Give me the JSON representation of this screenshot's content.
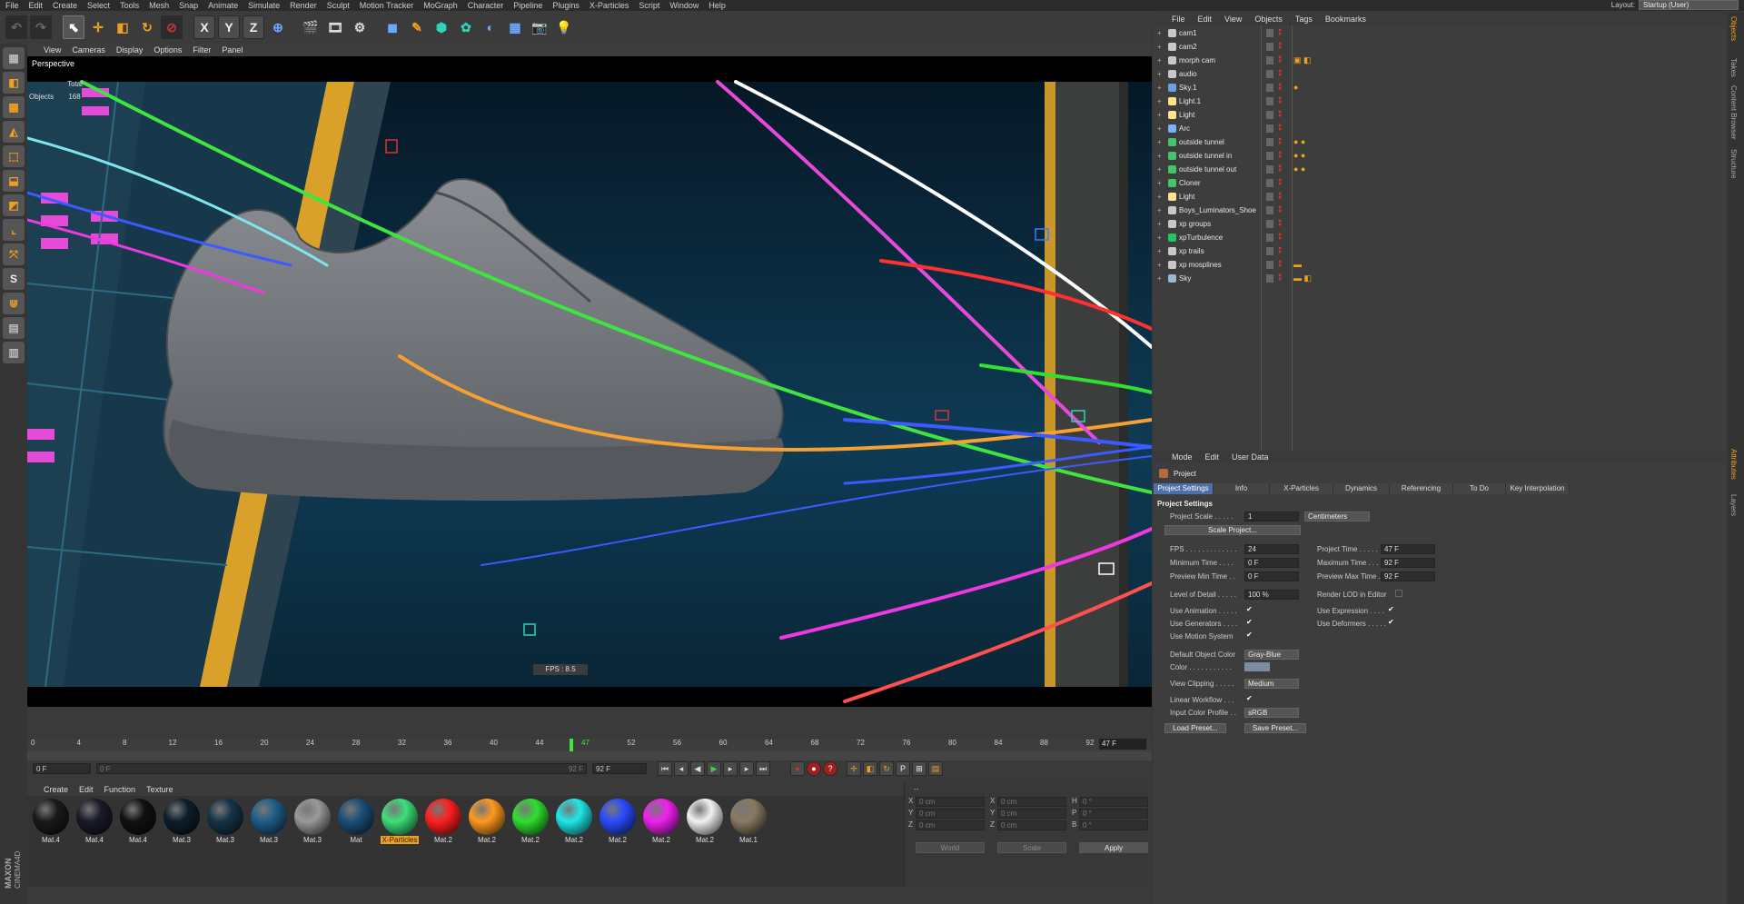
{
  "menubar": [
    "File",
    "Edit",
    "Create",
    "Select",
    "Tools",
    "Mesh",
    "Snap",
    "Animate",
    "Simulate",
    "Render",
    "Sculpt",
    "Motion Tracker",
    "MoGraph",
    "Character",
    "Pipeline",
    "Plugins",
    "X-Particles",
    "Script",
    "Window",
    "Help"
  ],
  "layout": {
    "label": "Layout:",
    "value": "Startup (User)"
  },
  "viewport": {
    "menu": [
      "View",
      "Cameras",
      "Display",
      "Options",
      "Filter",
      "Panel"
    ],
    "label": "Perspective",
    "stats_total": "Total",
    "stats_objects_label": "Objects",
    "stats_objects_value": "168",
    "fps": "FPS : 8.5"
  },
  "timeline": {
    "ticks": [
      "0",
      "4",
      "8",
      "12",
      "16",
      "20",
      "24",
      "28",
      "32",
      "36",
      "40",
      "44",
      "47",
      "52",
      "56",
      "60",
      "64",
      "68",
      "72",
      "76",
      "80",
      "84",
      "88",
      "92"
    ],
    "current_frame": "47 F",
    "start_field": "0 F",
    "min_field": "0 F",
    "max_field": "92 F",
    "end_field": "92 F"
  },
  "materials": {
    "menu": [
      "Create",
      "Edit",
      "Function",
      "Texture"
    ],
    "items": [
      {
        "label": "Mat.4",
        "color": "#1a1a1a",
        "hl": false
      },
      {
        "label": "Mat.4",
        "color": "#1a1a2a",
        "hl": false
      },
      {
        "label": "Mat.4",
        "color": "#111111",
        "hl": false
      },
      {
        "label": "Mat.3",
        "color": "#0d1e2a",
        "hl": false
      },
      {
        "label": "Mat.3",
        "color": "#143447",
        "hl": false
      },
      {
        "label": "Mat.3",
        "color": "#1f5d8a",
        "hl": false
      },
      {
        "label": "Mat.3",
        "color": "#9a9a9a",
        "hl": false
      },
      {
        "label": "Mat",
        "color": "#1b4e77",
        "hl": false
      },
      {
        "label": "X-Particles",
        "color": "#3de07a",
        "hl": true
      },
      {
        "label": "Mat.2",
        "color": "#ff1f1f",
        "hl": false
      },
      {
        "label": "Mat.2",
        "color": "#ff9a1f",
        "hl": false
      },
      {
        "label": "Mat.2",
        "color": "#2fe02f",
        "hl": false
      },
      {
        "label": "Mat.2",
        "color": "#1fe8e8",
        "hl": false
      },
      {
        "label": "Mat.2",
        "color": "#2a4bff",
        "hl": false
      },
      {
        "label": "Mat.2",
        "color": "#f020f0",
        "hl": false
      },
      {
        "label": "Mat.2",
        "color": "#f2f2f2",
        "hl": false
      },
      {
        "label": "Mat.1",
        "color": "#8a7a60",
        "hl": false
      }
    ]
  },
  "coords": {
    "header": "--",
    "rows": [
      {
        "a": "X",
        "av": "0 cm",
        "b": "X",
        "bv": "0 cm",
        "c": "H",
        "cv": "0 °"
      },
      {
        "a": "Y",
        "av": "0 cm",
        "b": "Y",
        "bv": "0 cm",
        "c": "P",
        "cv": "0 °"
      },
      {
        "a": "Z",
        "av": "0 cm",
        "b": "Z",
        "bv": "0 cm",
        "c": "B",
        "cv": "0 °"
      }
    ],
    "world": "World",
    "scale": "Scale",
    "apply": "Apply"
  },
  "objects_panel": {
    "menu": [
      "File",
      "Edit",
      "View",
      "Objects",
      "Tags",
      "Bookmarks"
    ],
    "rows": [
      {
        "name": "cam1",
        "icon": "#c8c8c8",
        "tag": ""
      },
      {
        "name": "cam2",
        "icon": "#c8c8c8",
        "tag": ""
      },
      {
        "name": "morph cam",
        "icon": "#c8c8c8",
        "tag": "▣ ◧"
      },
      {
        "name": "audio",
        "icon": "#c8c8c8",
        "tag": ""
      },
      {
        "name": "Sky.1",
        "icon": "#6a9fe0",
        "tag": "●"
      },
      {
        "name": "Light.1",
        "icon": "#ffe38a",
        "tag": ""
      },
      {
        "name": "Light",
        "icon": "#ffe38a",
        "tag": ""
      },
      {
        "name": "Arc",
        "icon": "#7ab0ff",
        "tag": ""
      },
      {
        "name": "outside tunnel",
        "icon": "#45c46b",
        "tag": "● ●"
      },
      {
        "name": "outside tunnel in",
        "icon": "#45c46b",
        "tag": "● ●"
      },
      {
        "name": "outside tunnel out",
        "icon": "#45c46b",
        "tag": "● ●"
      },
      {
        "name": "Cloner",
        "icon": "#45c46b",
        "tag": ""
      },
      {
        "name": "Light",
        "icon": "#ffe38a",
        "tag": ""
      },
      {
        "name": "Boys_Luminators_Shoe",
        "icon": "#c8c8c8",
        "tag": ""
      },
      {
        "name": "xp groups",
        "icon": "#c8c8c8",
        "tag": ""
      },
      {
        "name": "xpTurbulence",
        "icon": "#21c466",
        "tag": ""
      },
      {
        "name": "xp trails",
        "icon": "#c8c8c8",
        "tag": ""
      },
      {
        "name": "xp mosplines",
        "icon": "#c8c8c8",
        "tag": "▬"
      },
      {
        "name": "Sky",
        "icon": "#9cb5d0",
        "tag": "▬ ◧"
      }
    ]
  },
  "attributes": {
    "menu": [
      "Mode",
      "Edit",
      "User Data"
    ],
    "title": "Project",
    "tabs": [
      "Project Settings",
      "Info",
      "X-Particles",
      "Dynamics",
      "Referencing",
      "To Do",
      "Key Interpolation"
    ],
    "section": "Project Settings",
    "project_scale_label": "Project Scale . . . . .",
    "project_scale": "1",
    "project_scale_unit": "Centimeters",
    "scale_project_btn": "Scale Project...",
    "fps_label": "FPS . . . . . . . . . . . . .",
    "fps": "24",
    "project_time_label": "Project Time . . . . .",
    "project_time": "47 F",
    "min_time_label": "Minimum Time . . . .",
    "min_time": "0 F",
    "max_time_label": "Maximum Time . . . .",
    "max_time": "92 F",
    "prev_min_label": "Preview Min Time . .",
    "prev_min": "0 F",
    "prev_max_label": "Preview Max Time . .",
    "prev_max": "92 F",
    "lod_label": "Level of Detail . . . . .",
    "lod": "100 %",
    "render_lod_label": "Render LOD in Editor",
    "use_animation_label": "Use Animation . . . . .",
    "use_expression_label": "Use Expression . . . .",
    "use_generators_label": "Use Generators . . . .",
    "use_deformers_label": "Use Deformers . . . . .",
    "use_motion_label": "Use Motion System",
    "default_color_label": "Default Object Color",
    "default_color": "Gray-Blue",
    "color_label": "Color . . . . . . . . . . .",
    "view_clipping_label": "View Clipping . . . . .",
    "view_clipping": "Medium",
    "linear_workflow_label": "Linear Workflow . . .",
    "input_profile_label": "Input Color Profile . .",
    "input_profile": "sRGB",
    "load_preset": "Load Preset...",
    "save_preset": "Save Preset..."
  },
  "side_tabs": [
    "Objects",
    "Takes",
    "Content Browser",
    "Structure",
    "Attributes",
    "Layers"
  ],
  "colors": {
    "accent": "#f0a020",
    "tab_active": "#4f6fa8"
  }
}
